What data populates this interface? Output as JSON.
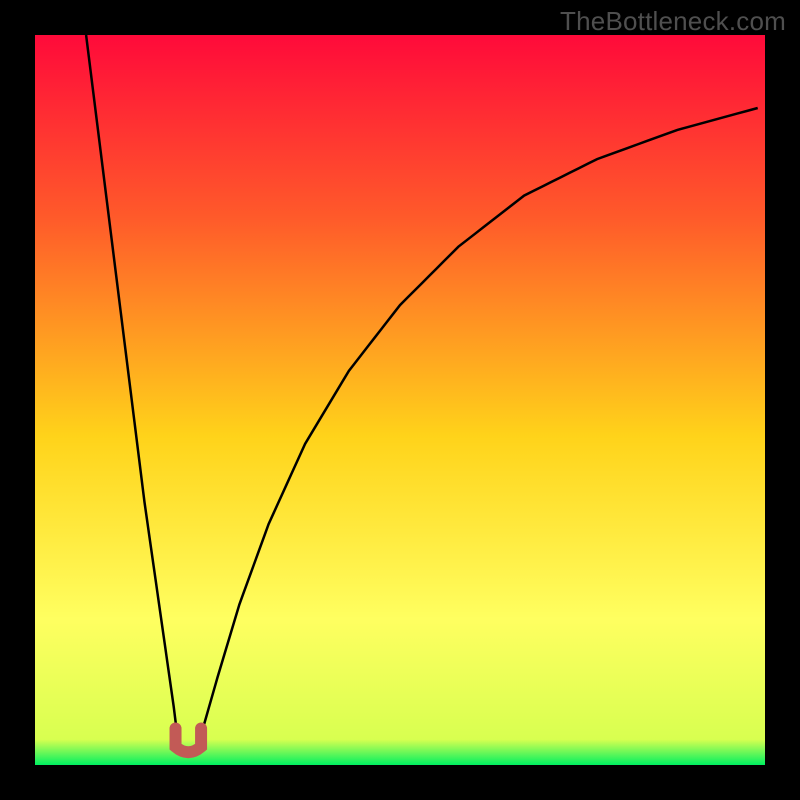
{
  "watermark": "TheBottleneck.com",
  "colors": {
    "top": "#ff0a3a",
    "upper_mid": "#ff5a2a",
    "mid": "#ffd31a",
    "lower_mid": "#ffff60",
    "bottom": "#00f060",
    "curve": "#000000",
    "marker": "#c25a56",
    "frame": "#000000"
  },
  "chart_data": {
    "type": "line",
    "title": "",
    "xlabel": "",
    "ylabel": "",
    "xlim": [
      0,
      100
    ],
    "ylim": [
      0,
      100
    ],
    "grid": false,
    "legend": false,
    "series": [
      {
        "name": "left-branch",
        "x": [
          7,
          8,
          9,
          10,
          11,
          12,
          13,
          14,
          15,
          16,
          17,
          18,
          19,
          19.5,
          20
        ],
        "y": [
          100,
          92,
          84,
          76,
          68,
          60,
          52,
          44,
          36,
          29,
          22,
          15,
          8,
          4,
          2
        ]
      },
      {
        "name": "right-branch",
        "x": [
          22,
          23,
          25,
          28,
          32,
          37,
          43,
          50,
          58,
          67,
          77,
          88,
          99
        ],
        "y": [
          2,
          5,
          12,
          22,
          33,
          44,
          54,
          63,
          71,
          78,
          83,
          87,
          90
        ]
      }
    ],
    "marker": {
      "name": "minimum-dip",
      "shape": "u",
      "x_center": 21,
      "x_width": 3.5,
      "y": 1.5,
      "color": "#c25a56"
    },
    "gradient_stops": [
      {
        "offset": 0.0,
        "color": "#ff0a3a"
      },
      {
        "offset": 0.25,
        "color": "#ff5a2a"
      },
      {
        "offset": 0.55,
        "color": "#ffd31a"
      },
      {
        "offset": 0.8,
        "color": "#ffff60"
      },
      {
        "offset": 0.965,
        "color": "#d8ff50"
      },
      {
        "offset": 1.0,
        "color": "#00f060"
      }
    ]
  }
}
